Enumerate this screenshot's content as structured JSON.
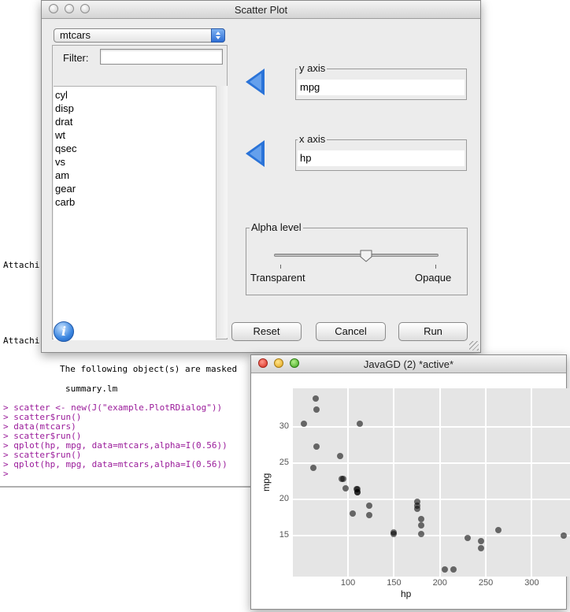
{
  "console": {
    "attach_1": "Attachi",
    "attach_2": "Attachi",
    "masked_line": "The following object(s) are masked",
    "summary_line": "summary.lm",
    "commands": [
      "> scatter <- new(J(\"example.PlotRDialog\"))",
      "> scatter$run()",
      "> data(mtcars)",
      "> scatter$run()",
      "> qplot(hp, mpg, data=mtcars,alpha=I(0.56))",
      "> scatter$run()",
      "> qplot(hp, mpg, data=mtcars,alpha=I(0.56))",
      ">"
    ]
  },
  "dialog": {
    "title": "Scatter Plot",
    "dataset": "mtcars",
    "filter_label": "Filter:",
    "filter_value": "",
    "variables": [
      "cyl",
      "disp",
      "drat",
      "wt",
      "qsec",
      "vs",
      "am",
      "gear",
      "carb"
    ],
    "y_axis": {
      "legend": "y axis",
      "value": "mpg"
    },
    "x_axis": {
      "legend": "x axis",
      "value": "hp"
    },
    "alpha": {
      "legend": "Alpha level",
      "min_label": "Transparent",
      "max_label": "Opaque",
      "value": 0.56
    },
    "buttons": {
      "reset": "Reset",
      "cancel": "Cancel",
      "run": "Run"
    },
    "icons": {
      "info": "info-icon",
      "arrow": "left-arrow-icon"
    },
    "accent_color": "#2a73d8"
  },
  "plot_window": {
    "title": "JavaGD (2) *active*"
  },
  "chart_data": {
    "type": "scatter",
    "xlabel": "hp",
    "ylabel": "mpg",
    "xlim": [
      40,
      345
    ],
    "ylim": [
      9.4,
      35.3
    ],
    "xticks": [
      100,
      150,
      200,
      250,
      300
    ],
    "yticks": [
      15,
      20,
      25,
      30
    ],
    "grid": true,
    "point_color": "#000000",
    "alpha": 0.56,
    "x": [
      110,
      110,
      93,
      110,
      175,
      105,
      245,
      62,
      95,
      123,
      123,
      180,
      180,
      180,
      205,
      215,
      230,
      66,
      52,
      65,
      97,
      150,
      150,
      245,
      175,
      66,
      91,
      113,
      264,
      175,
      335,
      109
    ],
    "y": [
      21.0,
      21.0,
      22.8,
      21.4,
      18.7,
      18.1,
      14.3,
      24.4,
      22.8,
      19.2,
      17.8,
      16.4,
      17.3,
      15.2,
      10.4,
      10.4,
      14.7,
      32.4,
      30.4,
      33.9,
      21.5,
      15.5,
      15.2,
      13.3,
      19.2,
      27.3,
      26.0,
      30.4,
      15.8,
      19.7,
      15.0,
      21.4
    ]
  }
}
